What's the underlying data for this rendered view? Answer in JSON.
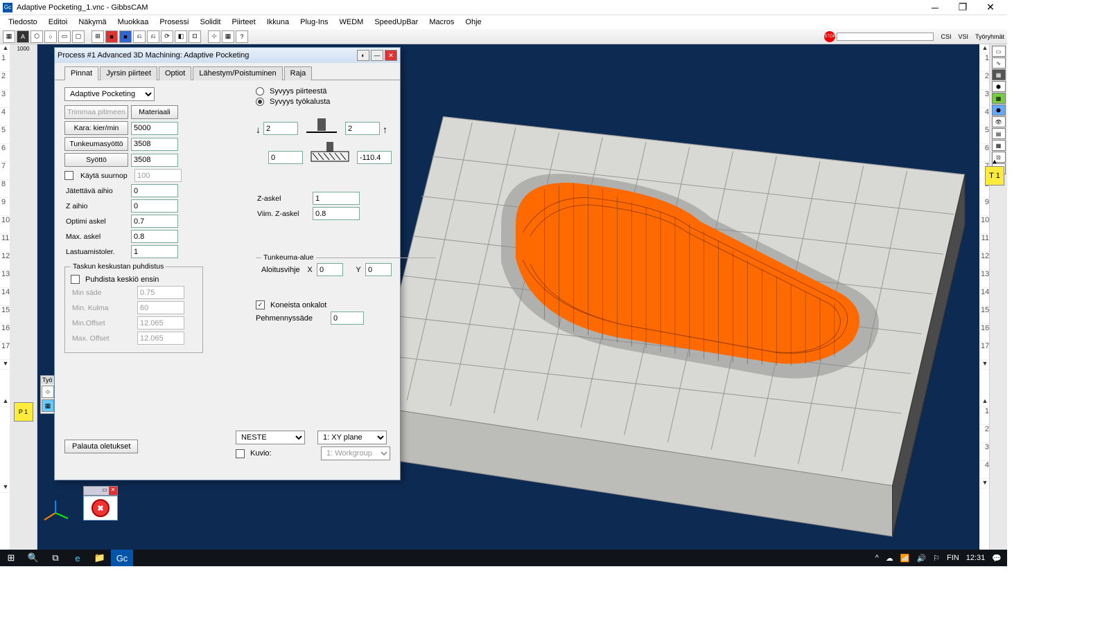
{
  "window": {
    "title": "Adaptive Pocketing_1.vnc - GibbsCAM",
    "app_short": "Gc"
  },
  "menu": [
    "Tiedosto",
    "Editoi",
    "Näkymä",
    "Muokkaa",
    "Prosessi",
    "Solidit",
    "Piirteet",
    "Ikkuna",
    "Plug-Ins",
    "WEDM",
    "SpeedUpBar",
    "Macros",
    "Ohje"
  ],
  "top_right_labels": {
    "csi": "CSI",
    "vsi": "VSI",
    "tyoryhmat": "Työryhmät"
  },
  "dialog": {
    "title": "Process #1 Advanced 3D Machining: Adaptive Pocketing",
    "tabs": [
      "Pinnat",
      "Jyrsin piirteet",
      "Optiot",
      "Lähestym/Poistuminen",
      "Raja"
    ],
    "active_tab": 0,
    "operation": "Adaptive Pocketing",
    "trimmaa": "Trimmaa pitimeen",
    "materiaali": "Materiaali",
    "kara_label": "Kara: kier/min",
    "kara": "5000",
    "tunk_label": "Tunkeumasyöttö",
    "tunk": "3508",
    "syotto_label": "Syöttö",
    "syotto": "3508",
    "kayta_suurnop": "Käytä suurnop",
    "kayta_suurnop_val": "100",
    "jatettava_label": "Jätettävä aihio",
    "jatettava": "0",
    "zaihio_label": "Z aihio",
    "zaihio": "0",
    "optimi_label": "Optimi askel",
    "optimi": "0.7",
    "max_label": "Max. askel",
    "max": "0.8",
    "lastu_label": "Lastuamistoler.",
    "lastu": "1",
    "depth_radio1": "Syvyys piirteestä",
    "depth_radio2": "Syvyys työkalusta",
    "depth_top_down": "2",
    "depth_top_up": "2",
    "depth_bottom_left": "0",
    "depth_bottom_right": "-110.4",
    "zaskel_label": "Z-askel",
    "zaskel": "1",
    "viimz_label": "Viim. Z-askel",
    "viimz": "0.8",
    "taskun_legend": "Taskun keskustan puhdistus",
    "puhdista": "Puhdista keskiö ensin",
    "minsade_label": "Min säde",
    "minsade": "0.75",
    "minkulma_label": "Min. Kulma",
    "minkulma": "60",
    "minoffset_label": "Min.Offset",
    "minoffset": "12.065",
    "maxoffset_label": "Max. Offset",
    "maxoffset": "12.065",
    "tunkeuma_legend": "Tunkeuma-alue",
    "aloitus_label": "Aloitusvihje",
    "aloitus_x": "0",
    "aloitus_y": "0",
    "koneista": "Koneista onkalot",
    "pehm_label": "Pehmennyssäde",
    "pehm": "0",
    "palauta": "Palauta oletukset",
    "neste": "NESTE",
    "xyplane": "1: XY plane",
    "kuvio": "Kuvio:",
    "workgroup": "1: Workgroup"
  },
  "left_tiles": {
    "p1_label": "P 1"
  },
  "right_tool": {
    "t1": "T 1"
  },
  "workpanel": {
    "title": "Työ"
  },
  "taskbar": {
    "lang": "FIN",
    "time": "12:31"
  },
  "ruler_label": "1000"
}
